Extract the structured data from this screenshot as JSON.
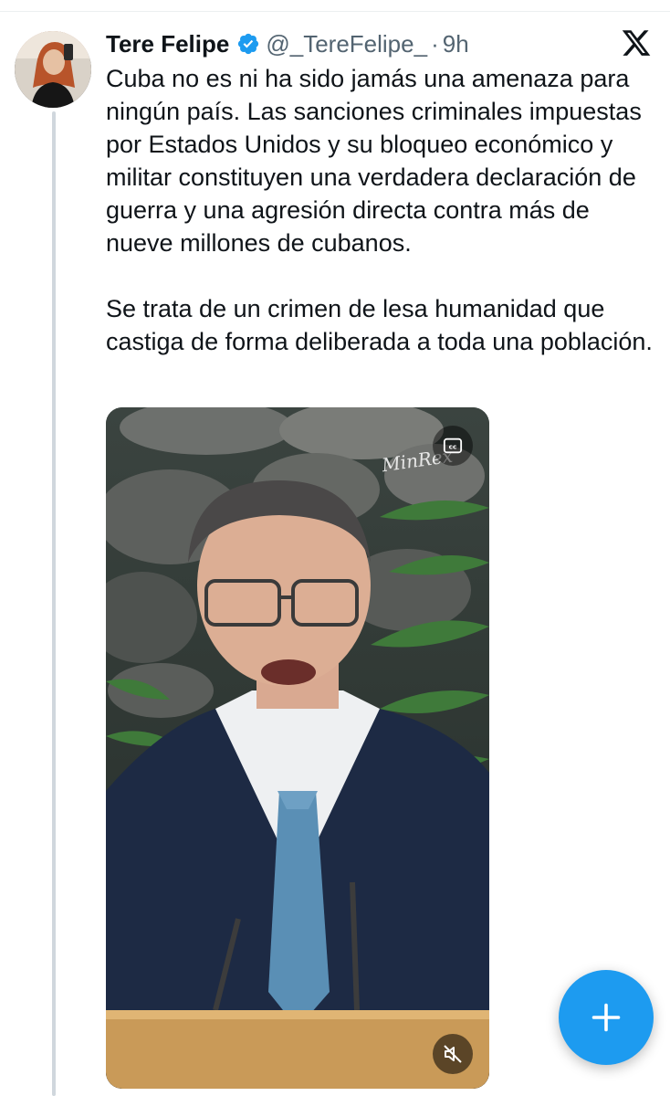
{
  "tweet": {
    "author_name": "Tere Felipe",
    "handle": "@_TereFelipe_",
    "separator": "·",
    "time": "9h",
    "paragraphs": [
      "Cuba no es ni ha sido jamás una amenaza para ningún país. Las sanciones criminales impuestas por Estados Unidos y su bloqueo económico y militar constituyen una verdadera declaración de guerra y una agresión directa contra más de nueve millones de cubanos.",
      "Se trata de un crimen de lesa humanidad que castiga de forma deliberada a toda una población."
    ],
    "media": {
      "watermark": "MinRex",
      "cc_icon": "closed-captions-icon",
      "mute_icon": "speaker-muted-icon"
    }
  },
  "icons": {
    "verified": "verified-badge-icon",
    "brand": "x-logo-icon",
    "compose": "plus-icon"
  },
  "colors": {
    "accent": "#1d9bf0",
    "text": "#0f1419",
    "secondary": "#536471"
  }
}
